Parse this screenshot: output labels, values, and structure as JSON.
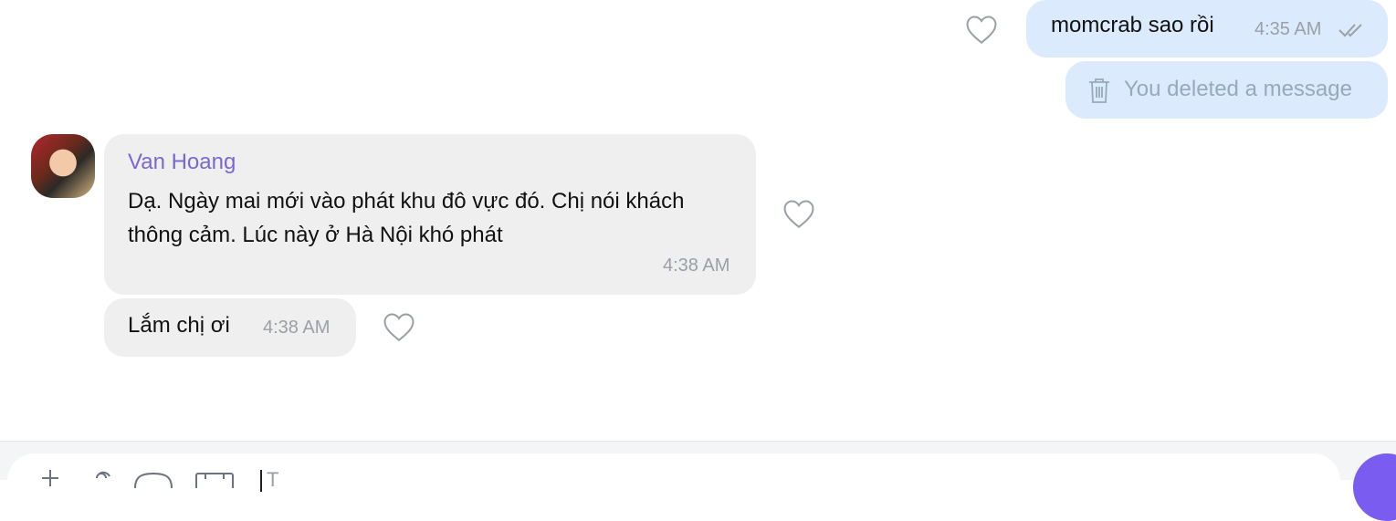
{
  "messages": {
    "outgoing_1": {
      "text": "momcrab sao rồi",
      "time": "4:35 AM"
    },
    "outgoing_deleted": {
      "text": "You deleted a message"
    },
    "incoming_1": {
      "sender": "Van Hoang",
      "line1": "Dạ. Ngày mai mới vào phát khu đô vực đó. Chị nói khách",
      "line2": "thông cảm. Lúc này ở Hà Nội khó phát",
      "time": "4:38 AM"
    },
    "incoming_2": {
      "text": "Lắm chị ơi",
      "time": "4:38 AM"
    }
  },
  "composer": {
    "placeholder": "T"
  },
  "colors": {
    "outgoing_bubble": "#dbeafc",
    "incoming_bubble": "#efefef",
    "sender_name": "#7b66d6",
    "send_button": "#7b5cf0"
  }
}
